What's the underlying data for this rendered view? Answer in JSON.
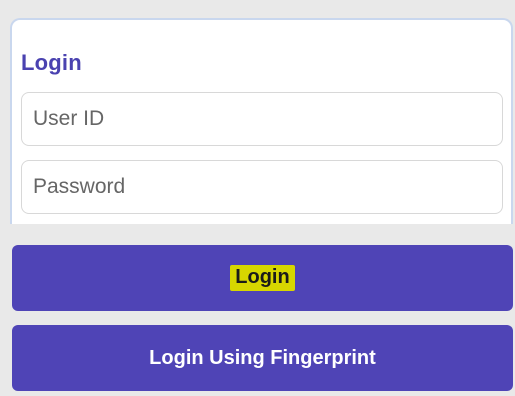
{
  "login_form": {
    "title": "Login",
    "user_id": {
      "value": "",
      "placeholder": "User ID"
    },
    "password": {
      "value": "",
      "placeholder": "Password"
    }
  },
  "buttons": {
    "login_label": "Login",
    "fingerprint_label": "Login Using Fingerprint"
  },
  "colors": {
    "primary": "#4f44b6",
    "title": "#4a42b0",
    "highlight": "#d7d600",
    "background": "#e9e9e9"
  }
}
